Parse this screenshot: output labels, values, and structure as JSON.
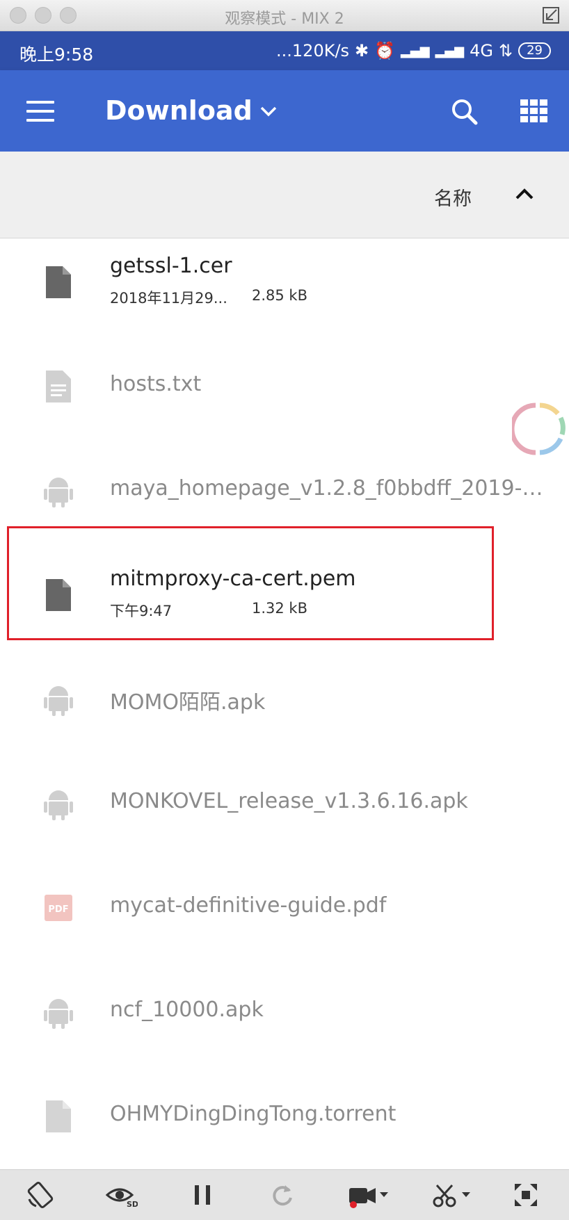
{
  "window": {
    "title": "观察模式 - MIX 2"
  },
  "statusbar": {
    "time": "晚上9:58",
    "network": "...120K/s",
    "network_type": "4G",
    "battery": "29"
  },
  "appbar": {
    "title": "Download"
  },
  "sort": {
    "label": "名称"
  },
  "files": [
    {
      "name": "getssl-1.cer",
      "date": "2018年11月29...",
      "size": "2.85 kB",
      "icon": "file-icon",
      "dim": false
    },
    {
      "name": "hosts.txt",
      "date": "",
      "size": "",
      "icon": "text-file-icon",
      "dim": true
    },
    {
      "name": "maya_homepage_v1.2.8_f0bbdff_2019-0...",
      "date": "",
      "size": "",
      "icon": "android-icon",
      "dim": true
    },
    {
      "name": "mitmproxy-ca-cert.pem",
      "date": "下午9:47",
      "size": "1.32 kB",
      "icon": "file-icon",
      "dim": false
    },
    {
      "name": "MOMO陌陌.apk",
      "date": "",
      "size": "",
      "icon": "android-icon",
      "dim": true
    },
    {
      "name": "MONKOVEL_release_v1.3.6.16.apk",
      "date": "",
      "size": "",
      "icon": "android-icon",
      "dim": true
    },
    {
      "name": "mycat-definitive-guide.pdf",
      "date": "",
      "size": "",
      "icon": "pdf-icon",
      "dim": true
    },
    {
      "name": "ncf_10000.apk",
      "date": "",
      "size": "",
      "icon": "android-icon",
      "dim": true
    },
    {
      "name": "OHMYDingDingTong.torrent",
      "date": "",
      "size": "",
      "icon": "file-icon",
      "dim": true
    }
  ],
  "colors": {
    "statusbar": "#2f4fa9",
    "appbar": "#3d67cf",
    "highlight": "#e0202a"
  }
}
